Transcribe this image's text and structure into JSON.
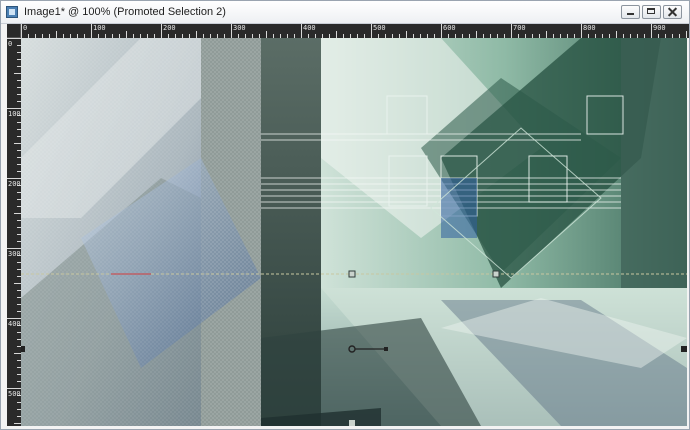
{
  "window": {
    "title": "Image1* @ 100% (Promoted Selection 2)",
    "app_icon": "image-document-icon",
    "controls": {
      "minimize": "minimize-icon",
      "maximize": "maximize-icon",
      "close": "close-icon"
    }
  },
  "ruler": {
    "horizontal_labels": [
      "0",
      "100",
      "200",
      "300",
      "400",
      "500",
      "600",
      "700",
      "800",
      "900"
    ],
    "vertical_labels": [
      "0",
      "100",
      "200",
      "300",
      "400",
      "500"
    ]
  },
  "canvas": {
    "content": "abstract geometric image",
    "palette": [
      "#cfd6d8",
      "#7f8f8c",
      "#2f4a44",
      "#a8d0bf",
      "#5c7da8",
      "#e8efe9"
    ],
    "selection_line_color": "#c8c7a0"
  }
}
